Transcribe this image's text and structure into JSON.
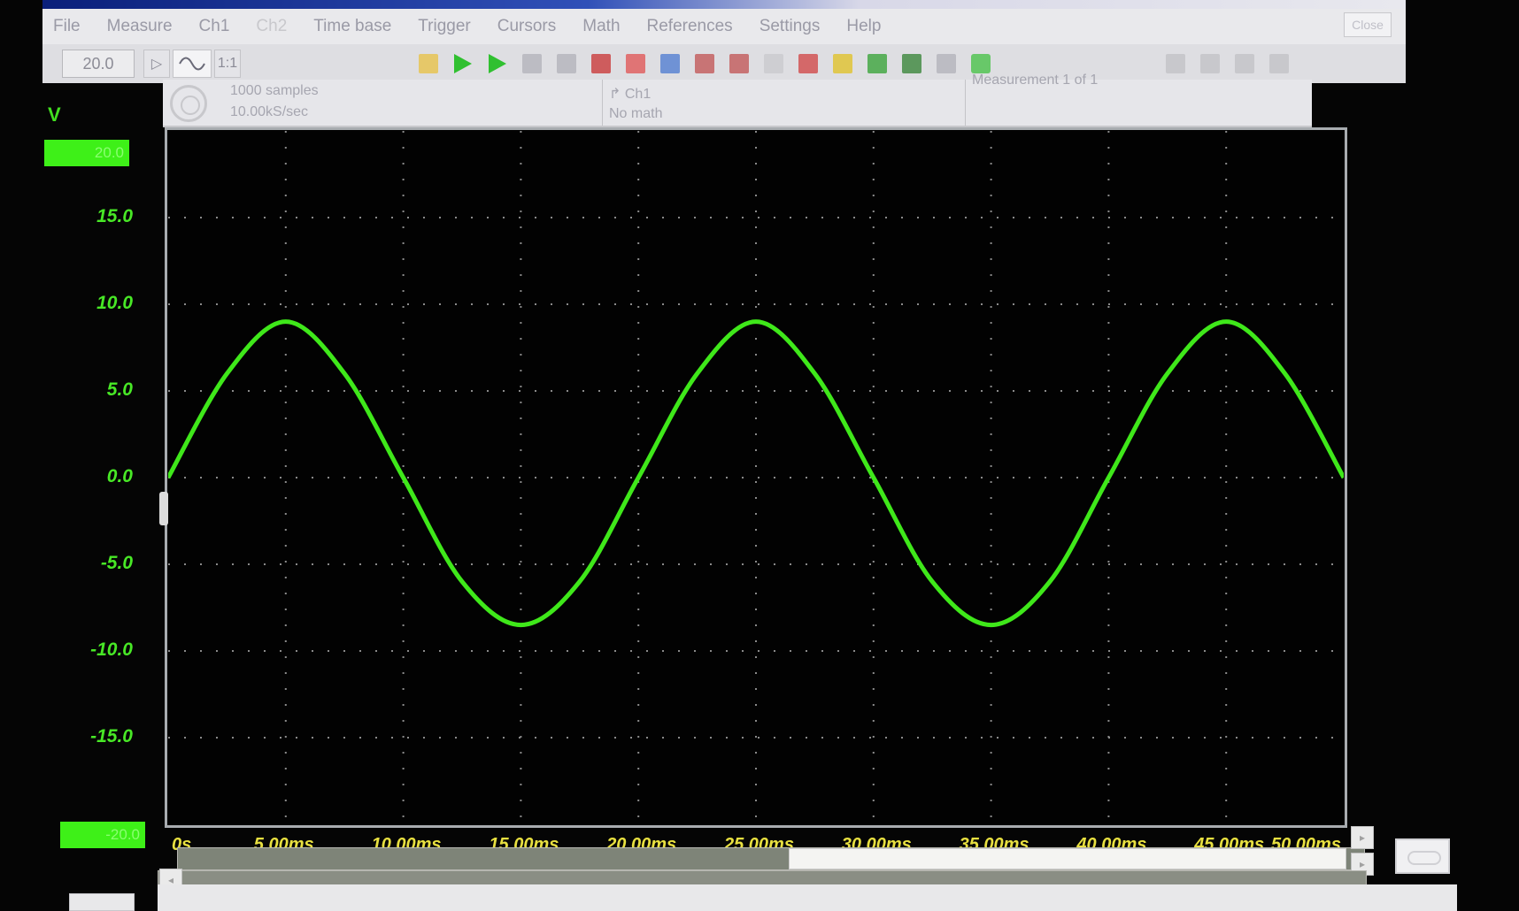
{
  "menu": {
    "items": [
      "File",
      "Measure",
      "Ch1",
      "Ch2",
      "Time base",
      "Trigger",
      "Cursors",
      "Math",
      "References",
      "Settings",
      "Help"
    ],
    "close_label": "Close"
  },
  "toolbar": {
    "timebase_value": "20.0",
    "buttons": [
      "prev",
      "sine-wave",
      "1:1"
    ],
    "icons": [
      {
        "name": "folder-icon",
        "color": "#e8c040"
      },
      {
        "name": "run-icon",
        "color": "#30c030"
      },
      {
        "name": "single-run-icon",
        "color": "#30c030"
      },
      {
        "name": "step-icon",
        "color": "#b0b0b8"
      },
      {
        "name": "trigger-icon",
        "color": "#b0b0b8"
      },
      {
        "name": "image-icon",
        "color": "#c83030"
      },
      {
        "name": "stop-icon",
        "color": "#e05050"
      },
      {
        "name": "grid-icon",
        "color": "#4a78d0"
      },
      {
        "name": "calendar-icon",
        "color": "#c05050"
      },
      {
        "name": "copy-icon",
        "color": "#c05050"
      },
      {
        "name": "blank-icon",
        "color": "#c8c8cc"
      },
      {
        "name": "zoom-icon",
        "color": "#d04040"
      },
      {
        "name": "pencil-icon",
        "color": "#e0c020"
      },
      {
        "name": "chart-icon",
        "color": "#30a030"
      },
      {
        "name": "compare-icon",
        "color": "#308030"
      },
      {
        "name": "bracket-icon",
        "color": "#b0b0b8"
      },
      {
        "name": "record-icon",
        "color": "#40c040"
      },
      {
        "name": "tile-icon",
        "color": "#c0c0c4"
      },
      {
        "name": "cross-icon",
        "color": "#c0c0c4"
      },
      {
        "name": "arrow-icon",
        "color": "#c0c0c4"
      },
      {
        "name": "ellipsis-icon",
        "color": "#c0c0c4"
      }
    ]
  },
  "info": {
    "samples": "1000 samples",
    "rate": "10.00kS/sec",
    "trigger_channel": "Ch1",
    "math": "No math",
    "measurement": "Measurement 1 of 1"
  },
  "display": {
    "unit": "V",
    "range_top": "20.0",
    "range_bottom": "-20.0",
    "trace_color": "#3fe81a",
    "text_color": "#48e826",
    "xtick_color": "#e8e040"
  },
  "chart_data": {
    "type": "line",
    "title": "",
    "xlabel": "",
    "ylabel": "V",
    "xlim": [
      0,
      50
    ],
    "ylim": [
      -20,
      20
    ],
    "grid": true,
    "yticks": [
      "15.0",
      "10.0",
      "5.0",
      "0.0",
      "-5.0",
      "-10.0",
      "-15.0"
    ],
    "ytick_values": [
      15,
      10,
      5,
      0,
      -5,
      -10,
      -15
    ],
    "xticks": [
      "0s",
      "5.00ms",
      "10.00ms",
      "15.00ms",
      "20.00ms",
      "25.00ms",
      "30.00ms",
      "35.00ms",
      "40.00ms",
      "45.00ms",
      "50.00ms"
    ],
    "xtick_values": [
      0,
      5,
      10,
      15,
      20,
      25,
      30,
      35,
      40,
      45,
      50
    ],
    "series": [
      {
        "x": [
          0,
          2.5,
          5,
          7.5,
          10,
          12.5,
          15,
          17.5,
          20,
          22.5,
          25,
          27.5,
          30,
          32.5,
          35,
          37.5,
          40,
          42.5,
          45,
          47.5,
          50
        ],
        "y": [
          0,
          6,
          9,
          6,
          0,
          -6,
          -8.5,
          -6,
          0,
          6,
          9,
          6,
          0,
          -6,
          -8.5,
          -6,
          0,
          6,
          9,
          6,
          0
        ]
      }
    ]
  }
}
